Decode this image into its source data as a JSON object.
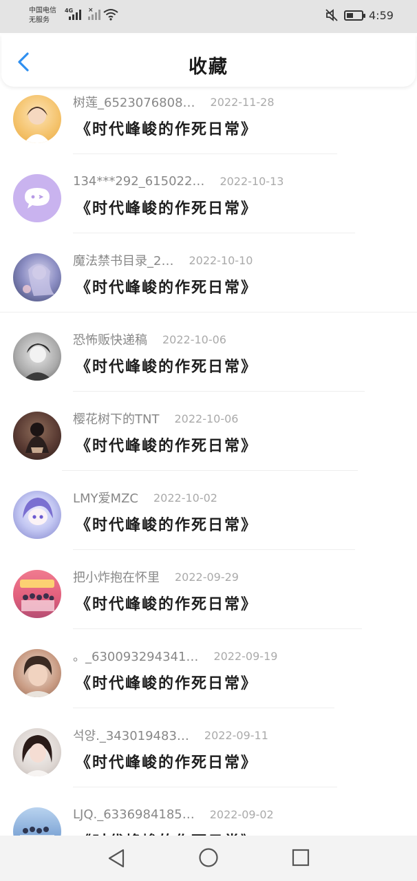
{
  "status_bar": {
    "carrier_line1": "中国电信",
    "carrier_line2": "无服务",
    "network": "4G",
    "sim2": "×",
    "time": "4:59"
  },
  "header": {
    "title": "收藏"
  },
  "favorites": [
    {
      "username": "树莲_6523076808…",
      "date": "2022-11-28",
      "book": "《时代峰峻的作死日常》",
      "avatar_color": "#f2c36b"
    },
    {
      "username": "134***292_615022…",
      "date": "2022-10-13",
      "book": "《时代峰峻的作死日常》",
      "avatar_color": "#c9b3ef"
    },
    {
      "username": "魔法禁书目录_2…",
      "date": "2022-10-10",
      "book": "《时代峰峻的作死日常》",
      "avatar_color": "#6a6fa8"
    },
    {
      "username": "恐怖贩快递稿",
      "date": "2022-10-06",
      "book": "《时代峰峻的作死日常》",
      "avatar_color": "#8a8a8a"
    },
    {
      "username": "樱花树下的TNT",
      "date": "2022-10-06",
      "book": "《时代峰峻的作死日常》",
      "avatar_color": "#5a3b33"
    },
    {
      "username": "LMY爱MZC",
      "date": "2022-10-02",
      "book": "《时代峰峻的作死日常》",
      "avatar_color": "#9aa3e8"
    },
    {
      "username": "把小炸抱在怀里",
      "date": "2022-09-29",
      "book": "《时代峰峻的作死日常》",
      "avatar_color": "#e87b8e"
    },
    {
      "username": "。_630093294341…",
      "date": "2022-09-19",
      "book": "《时代峰峻的作死日常》",
      "avatar_color": "#c89a82"
    },
    {
      "username": "석양._343019483…",
      "date": "2022-09-11",
      "book": "《时代峰峻的作死日常》",
      "avatar_color": "#ded7d3"
    },
    {
      "username": "LJQ._6336984185…",
      "date": "2022-09-02",
      "book": "《时代峰峻的作死日常》",
      "avatar_color": "#7fa6d6"
    }
  ],
  "colors": {
    "accent": "#2f8ff0",
    "status_bar_bg": "#e4e4e4",
    "nav_bar_bg": "#f3f3f3"
  }
}
